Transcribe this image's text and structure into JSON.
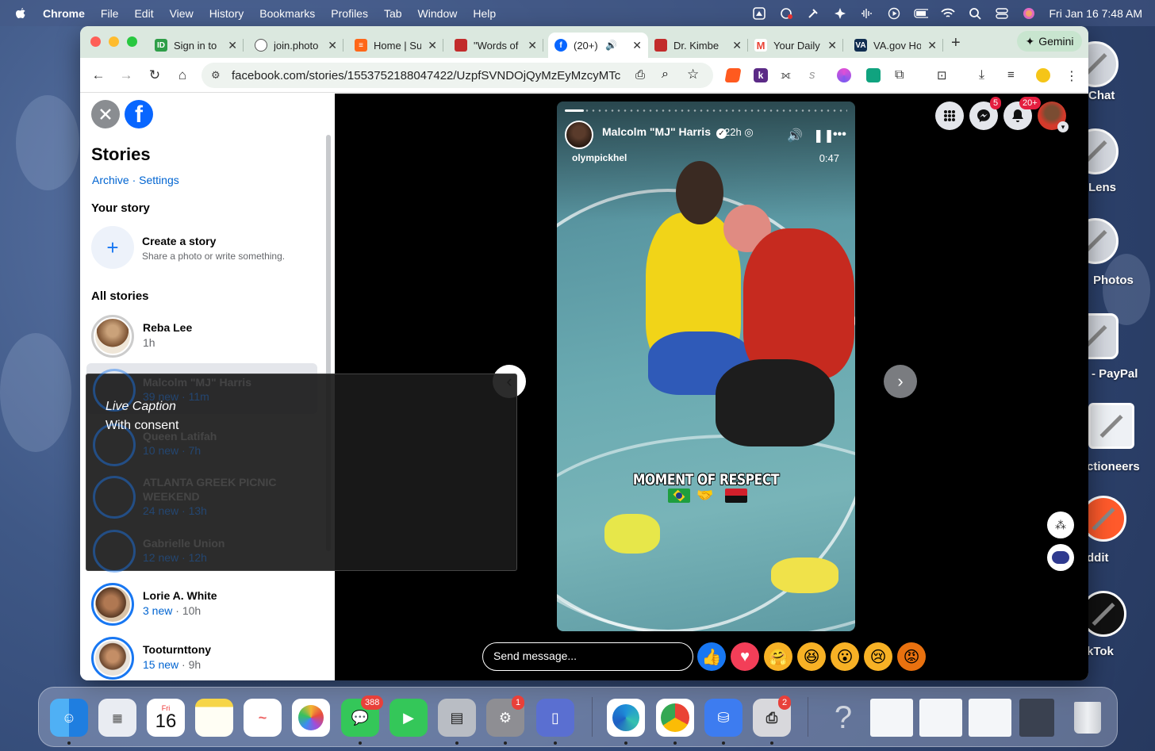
{
  "menubar": {
    "app": "Chrome",
    "items": [
      "File",
      "Edit",
      "View",
      "History",
      "Bookmarks",
      "Profiles",
      "Tab",
      "Window",
      "Help"
    ],
    "datetime": "Fri Jan 16  7:48 AM"
  },
  "desktop_items": [
    "Chat",
    "Lens",
    "Photos",
    "- PayPal",
    "ctioneers",
    "ddit",
    "kTok"
  ],
  "tabs": [
    {
      "title": "Sign in to",
      "icon": "id-icon",
      "color": "#2e9e48"
    },
    {
      "title": "join.photo",
      "icon": "globe-icon",
      "color": "#555555"
    },
    {
      "title": "Home | Su",
      "icon": "substack-icon",
      "color": "#ff6719"
    },
    {
      "title": "\"Words of",
      "icon": "site-icon",
      "color": "#c22b2b"
    },
    {
      "title": "(20+)",
      "icon": "facebook-icon",
      "color": "#0866ff",
      "active": true
    },
    {
      "title": "Dr. Kimbe",
      "icon": "site-icon",
      "color": "#c22b2b"
    },
    {
      "title": "Your Daily",
      "icon": "gmail-icon",
      "color": "#ea4335"
    },
    {
      "title": "VA.gov Ho",
      "icon": "va-icon",
      "color": "#112e51"
    }
  ],
  "gemini_label": "Gemini",
  "address": "facebook.com/stories/1553752188047422/UzpfSVNDOjQyMzEyMzcyMTc...",
  "sidebar": {
    "title": "Stories",
    "archive": "Archive",
    "dot": "·",
    "settings": "Settings",
    "your_story": "Your story",
    "create_title": "Create a story",
    "create_sub": "Share a photo or write something.",
    "all_stories": "All stories",
    "stories": [
      {
        "name": "Reba Lee",
        "new": "",
        "time": "1h"
      },
      {
        "name": "Malcolm \"MJ\" Harris",
        "new": "39 new",
        "time": "11m"
      },
      {
        "name": "Queen Latifah",
        "new": "10 new",
        "time": "7h"
      },
      {
        "name": "ATLANTA GREEK PICNIC",
        "name2": "WEEKEND",
        "new": "24 new",
        "time": "13h"
      },
      {
        "name": "Gabrielle Union",
        "new": "12 new",
        "time": "12h"
      },
      {
        "name": "Lorie A. White",
        "new": "3 new",
        "time": "10h"
      },
      {
        "name": "Tooturnttony",
        "new": "15 new",
        "time": "9h"
      }
    ]
  },
  "story": {
    "author": "Malcolm \"MJ\" Harris",
    "age": "22h",
    "source": "olympickhel",
    "duration": "0:47",
    "overlay_text": "MOMENT OF RESPECT",
    "flags": [
      "brazil-flag-icon",
      "handshake-icon",
      "angola-flag-icon"
    ]
  },
  "header_badges": {
    "messenger": "5",
    "notifications": "20+"
  },
  "message_placeholder": "Send message...",
  "reactions": [
    "like-icon",
    "love-icon",
    "care-icon",
    "haha-icon",
    "wow-icon",
    "sad-icon",
    "angry-icon"
  ],
  "live_caption": {
    "title": "Live Caption",
    "text": "With consent"
  },
  "dock": {
    "calendar_day": "Fri",
    "calendar_date": "16",
    "messages_badge": "388",
    "settings_badge": "1",
    "printer_badge": "2"
  }
}
